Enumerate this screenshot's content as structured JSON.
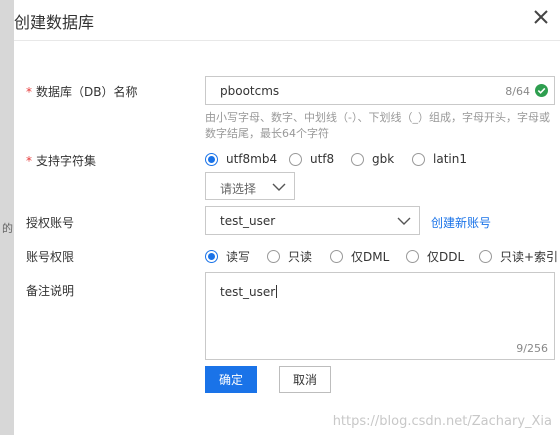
{
  "dialog": {
    "title": "创建数据库",
    "close_icon": "close-icon"
  },
  "backdrop": {
    "peek_text": "的"
  },
  "form": {
    "db_name": {
      "required_mark": "*",
      "label": "数据库（DB）名称",
      "value": "pbootcms",
      "counter": "8/64",
      "status_icon": "check-circle-icon",
      "hint": "由小写字母、数字、中划线（-）、下划线（_）组成，字母开头，字母或数字结尾，最长64个字符"
    },
    "charset": {
      "required_mark": "*",
      "label": "支持字符集",
      "options": [
        "utf8mb4",
        "utf8",
        "gbk",
        "latin1"
      ],
      "selected": "utf8mb4",
      "collation_placeholder": "请选择"
    },
    "account": {
      "label": "授权账号",
      "value": "test_user",
      "create_link": "创建新账号"
    },
    "permission": {
      "label": "账号权限",
      "options": [
        "读写",
        "只读",
        "仅DML",
        "仅DDL",
        "只读+索引"
      ],
      "selected": "读写"
    },
    "remark": {
      "label": "备注说明",
      "value": "test_user",
      "counter": "9/256"
    }
  },
  "buttons": {
    "confirm": "确定",
    "cancel": "取消"
  },
  "watermark": "https://blog.csdn.net/Zachary_Xia",
  "colors": {
    "accent": "#1a73e8",
    "success": "#2e9e4f",
    "required": "#e63c3c"
  }
}
